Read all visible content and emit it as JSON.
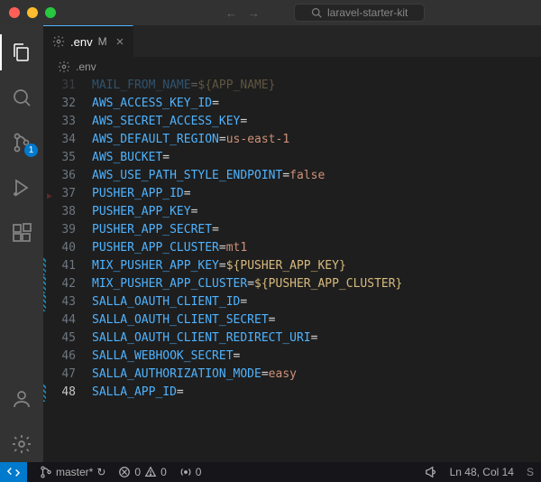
{
  "titlebar": {
    "search_placeholder": "laravel-starter-kit"
  },
  "activity": {
    "scm_badge": "1"
  },
  "tabs": {
    "active": {
      "label": ".env",
      "modified_marker": "M"
    }
  },
  "breadcrumb": {
    "file": ".env"
  },
  "editor": {
    "lines": [
      {
        "num": 31,
        "key": "MAIL_FROM_NAME",
        "value": "${APP_NAME}",
        "dim": true
      },
      {
        "num": 32,
        "key": "AWS_ACCESS_KEY_ID",
        "value": ""
      },
      {
        "num": 33,
        "key": "AWS_SECRET_ACCESS_KEY",
        "value": ""
      },
      {
        "num": 34,
        "key": "AWS_DEFAULT_REGION",
        "value": "us-east-1"
      },
      {
        "num": 35,
        "key": "AWS_BUCKET",
        "value": ""
      },
      {
        "num": 36,
        "key": "AWS_USE_PATH_STYLE_ENDPOINT",
        "value": "false"
      },
      {
        "num": 37,
        "key": "PUSHER_APP_ID",
        "value": "",
        "bp_hint": true
      },
      {
        "num": 38,
        "key": "PUSHER_APP_KEY",
        "value": ""
      },
      {
        "num": 39,
        "key": "PUSHER_APP_SECRET",
        "value": ""
      },
      {
        "num": 40,
        "key": "PUSHER_APP_CLUSTER",
        "value": "mt1"
      },
      {
        "num": 41,
        "key": "MIX_PUSHER_APP_KEY",
        "value": "${PUSHER_APP_KEY}",
        "mark": "mod"
      },
      {
        "num": 42,
        "key": "MIX_PUSHER_APP_CLUSTER",
        "value": "${PUSHER_APP_CLUSTER}",
        "mark": "mod"
      },
      {
        "num": 43,
        "key": "SALLA_OAUTH_CLIENT_ID",
        "value": "",
        "mark": "mod"
      },
      {
        "num": 44,
        "key": "SALLA_OAUTH_CLIENT_SECRET",
        "value": ""
      },
      {
        "num": 45,
        "key": "SALLA_OAUTH_CLIENT_REDIRECT_URI",
        "value": ""
      },
      {
        "num": 46,
        "key": "SALLA_WEBHOOK_SECRET",
        "value": ""
      },
      {
        "num": 47,
        "key": "SALLA_AUTHORIZATION_MODE",
        "value": "easy"
      },
      {
        "num": 48,
        "key": "SALLA_APP_ID",
        "value": "",
        "mark": "mod",
        "current": true
      }
    ]
  },
  "status": {
    "branch": "master*",
    "sync": "↻",
    "errors": "0",
    "warnings": "0",
    "radio": "0",
    "ln_col": "Ln 48, Col 14"
  }
}
